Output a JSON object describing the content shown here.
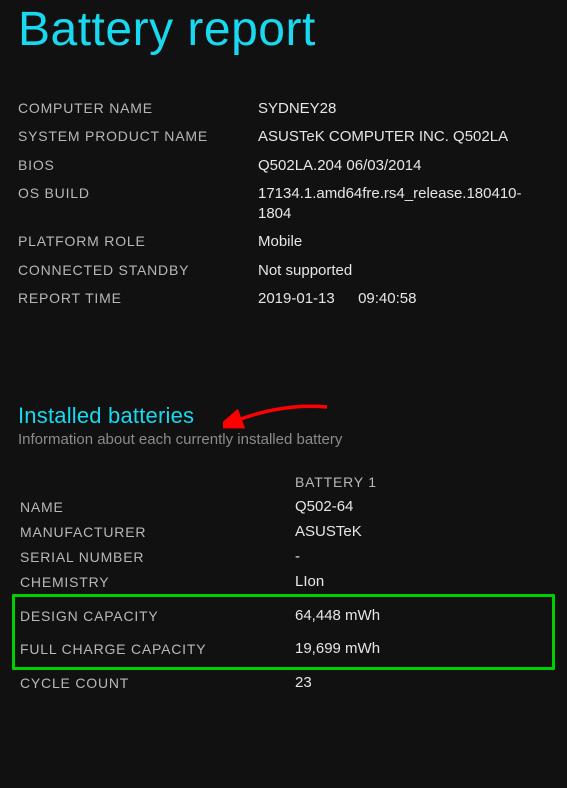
{
  "title": "Battery report",
  "system": {
    "computerName": {
      "label": "COMPUTER NAME",
      "value": "SYDNEY28"
    },
    "systemProductName": {
      "label": "SYSTEM PRODUCT NAME",
      "value": "ASUSTeK COMPUTER INC. Q502LA"
    },
    "bios": {
      "label": "BIOS",
      "value": "Q502LA.204 06/03/2014"
    },
    "osBuild": {
      "label": "OS BUILD",
      "value": "17134.1.amd64fre.rs4_release.180410-1804"
    },
    "platformRole": {
      "label": "PLATFORM ROLE",
      "value": "Mobile"
    },
    "connectedStandby": {
      "label": "CONNECTED STANDBY",
      "value": "Not supported"
    },
    "reportTime": {
      "label": "REPORT TIME",
      "value": "2019-01-13  09:40:58"
    }
  },
  "installedBatteries": {
    "heading": "Installed batteries",
    "subheading": "Information about each currently installed battery",
    "columnHeader": "BATTERY 1",
    "rows": {
      "name": {
        "label": "NAME",
        "value": "Q502-64"
      },
      "manufacturer": {
        "label": "MANUFACTURER",
        "value": "ASUSTeK"
      },
      "serialNumber": {
        "label": "SERIAL NUMBER",
        "value": "-"
      },
      "chemistry": {
        "label": "CHEMISTRY",
        "value": "LIon"
      },
      "designCapacity": {
        "label": "DESIGN CAPACITY",
        "value": "64,448 mWh"
      },
      "fullChargeCapacity": {
        "label": "FULL CHARGE CAPACITY",
        "value": "19,699 mWh"
      },
      "cycleCount": {
        "label": "CYCLE COUNT",
        "value": "23"
      }
    }
  },
  "annotationColors": {
    "arrow": "#ff0000",
    "highlightBox": "#00d000"
  }
}
